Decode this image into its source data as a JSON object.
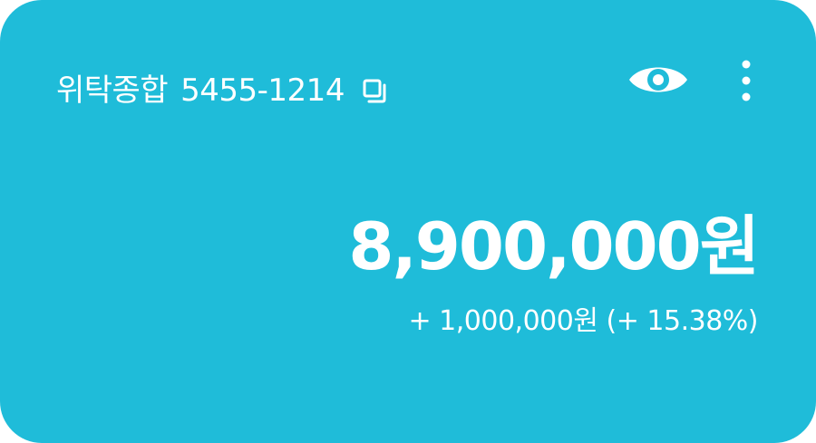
{
  "account": {
    "name": "위탁종합",
    "number": "5455-1214"
  },
  "icons": {
    "copy": "copy-icon",
    "visibility": "eye-icon",
    "menu": "more-vertical-icon"
  },
  "balance": {
    "amount": "8,900,000원"
  },
  "change": {
    "amount": "+ 1,000,000원",
    "percent": "(+ 15.38%)"
  },
  "colors": {
    "card_background": "#1fbcd9",
    "text": "#ffffff"
  }
}
